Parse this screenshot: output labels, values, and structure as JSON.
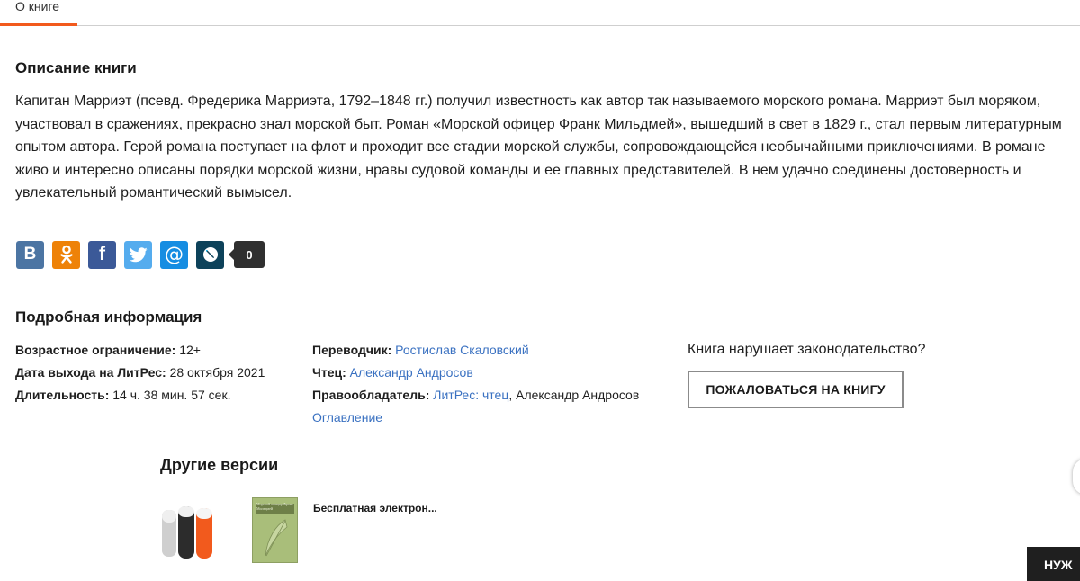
{
  "tabs": {
    "active": "О книге"
  },
  "description": {
    "title": "Описание книги",
    "text": "Капитан Марриэт (псевд. Фредерика Марриэта, 1792–1848 гг.) получил известность как автор так называемого морского романа. Марриэт был моряком, участвовал в сражениях, прекрасно знал морской быт. Роман «Морской офицер Франк Мильдмей», вышедший в свет в 1829 г., стал первым литературным опытом автора. Герой романа поступает на флот и проходит все стадии морской службы, сопровождающейся необычайными приключениями. В романе живо и интересно описаны порядки морской жизни, нравы судовой команды и ее главных представителей. В нем удачно соединены достоверность и увлекательный романтический вымысел."
  },
  "share": {
    "buttons": [
      {
        "name": "vk-icon",
        "color": "#4c75a3"
      },
      {
        "name": "odnoklassniki-icon",
        "color": "#ee8208"
      },
      {
        "name": "facebook-icon",
        "color": "#3b5998"
      },
      {
        "name": "twitter-icon",
        "color": "#55acee"
      },
      {
        "name": "mail-ru-icon",
        "color": "#168de2"
      },
      {
        "name": "livejournal-icon",
        "color": "#0d425a"
      }
    ],
    "count": "0"
  },
  "details": {
    "title": "Подробная информация",
    "age_label": "Возрастное ограничение:",
    "age_value": "12+",
    "release_label": "Дата выхода на ЛитРес:",
    "release_value": "28 октября 2021",
    "duration_label": "Длительность:",
    "duration_value": "14 ч. 38 мин. 57 сек.",
    "translator_label": "Переводчик:",
    "translator_value": "Ростислав Скаловский",
    "reader_label": "Чтец:",
    "reader_value": "Александр Андросов",
    "rights_label": "Правообладатель:",
    "rights_link": "ЛитРес: чтец",
    "rights_rest": ", Александр Андросов",
    "toc_link": "Оглавление"
  },
  "complaint": {
    "question": "Книга нарушает законодательство?",
    "button": "ПОЖАЛОВАТЬСЯ НА КНИГУ"
  },
  "versions": {
    "title": "Другие версии",
    "item_label": "Бесплатная электрон...",
    "book_cover_text": "Морской офицер Франк Мильдмей"
  },
  "corner_button": "НУЖ",
  "colors": {
    "accent": "#f25a1d",
    "link": "#3a71c1"
  }
}
